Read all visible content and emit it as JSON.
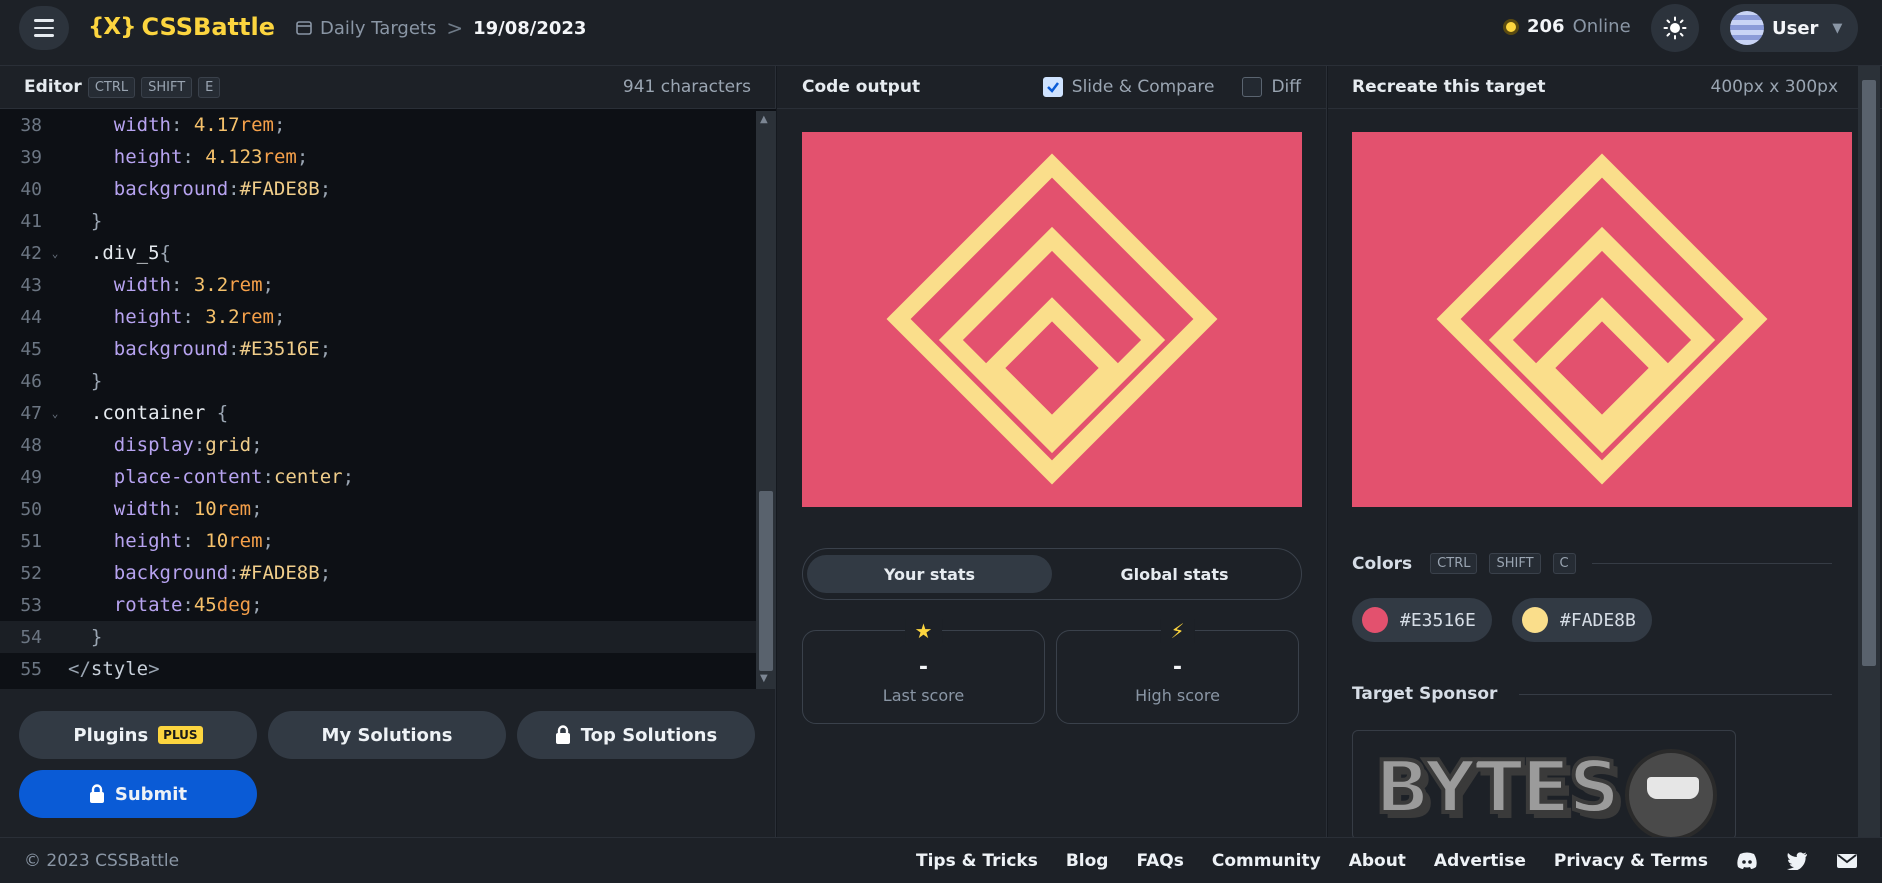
{
  "header": {
    "logo": "CSSBattle",
    "logo_mark": "{X}",
    "breadcrumb_link": "Daily Targets",
    "breadcrumb_sep": ">",
    "breadcrumb_current": "19/08/2023",
    "online_count": "206",
    "online_label": "Online",
    "user_name": "User"
  },
  "editor": {
    "title": "Editor",
    "shortcut_keys": [
      "CTRL",
      "SHIFT",
      "E"
    ],
    "char_count": "941 characters",
    "buttons": {
      "plugins": "Plugins",
      "plugins_badge": "PLUS",
      "my_solutions": "My Solutions",
      "top_solutions": "Top Solutions",
      "submit": "Submit"
    }
  },
  "output": {
    "title": "Code output",
    "slide_compare_label": "Slide & Compare",
    "slide_compare_checked": true,
    "diff_label": "Diff",
    "diff_checked": false,
    "tabs": [
      "Your stats",
      "Global stats"
    ],
    "last_score_value": "-",
    "last_score_label": "Last score",
    "high_score_value": "-",
    "high_score_label": "High score"
  },
  "target": {
    "title": "Recreate this target",
    "dimensions": "400px x 300px",
    "colors_title": "Colors",
    "colors_keys": [
      "CTRL",
      "SHIFT",
      "C"
    ],
    "colors": [
      {
        "hex": "#E3516E",
        "label": "#E3516E"
      },
      {
        "hex": "#FADE8B",
        "label": "#FADE8B"
      }
    ],
    "sponsor_title": "Target Sponsor",
    "sponsor_text": "BYTES"
  },
  "footer": {
    "copyright": "© 2023 CSSBattle",
    "links": [
      "Tips & Tricks",
      "Blog",
      "FAQs",
      "Community",
      "About",
      "Advertise",
      "Privacy & Terms"
    ]
  }
}
